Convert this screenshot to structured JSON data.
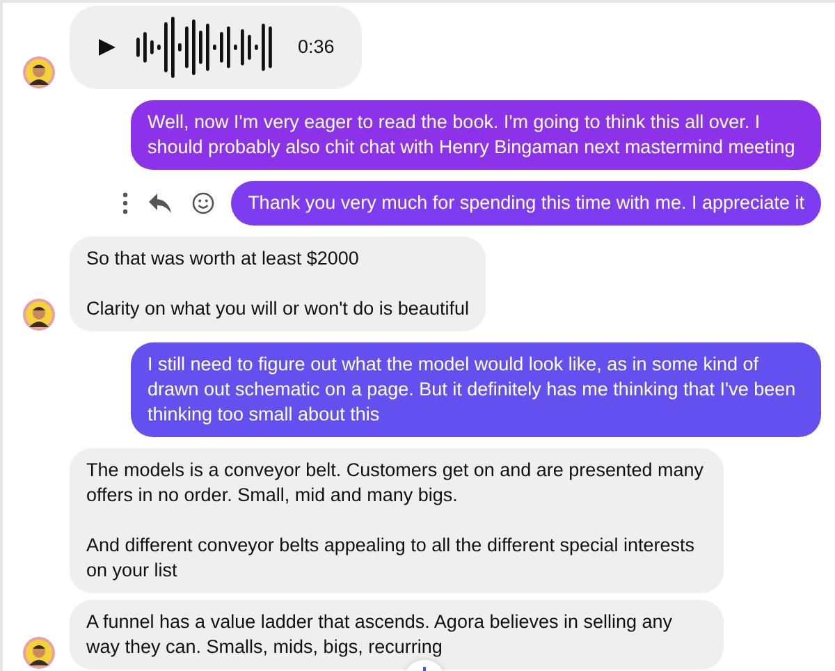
{
  "messages": [
    {
      "kind": "voice",
      "outgoing": false,
      "avatar": true,
      "duration": "0:36"
    },
    {
      "kind": "text",
      "outgoing": true,
      "color": "#8c33ea",
      "text": "Well, now I'm very eager to read the book. I'm going to think this all over. I should probably also chit chat with Henry Bingaman next mastermind meeting",
      "show_actions": false
    },
    {
      "kind": "text",
      "outgoing": true,
      "color": "#7d3cf0",
      "text": "Thank you very much for spending this time with me. I appreciate it",
      "show_actions": true
    },
    {
      "kind": "text",
      "outgoing": false,
      "avatar": true,
      "text": "So that was worth at least $2000\n\nClarity on what you will or won't do is beautiful"
    },
    {
      "kind": "text",
      "outgoing": true,
      "color": "#6450ee",
      "text": "I still need to figure out what the model would look like, as in some kind of drawn out schematic on a page. But it definitely has me thinking that I've been thinking too small about this",
      "show_actions": false
    },
    {
      "kind": "text",
      "outgoing": false,
      "avatar": false,
      "text": "The models is a conveyor belt. Customers get on and are presented many offers in no order. Small, mid and many bigs.\n\nAnd different conveyor belts appealing to all the different special interests on your list"
    },
    {
      "kind": "text",
      "outgoing": false,
      "avatar": true,
      "text": "A funnel has a value ladder that ascends. Agora believes in selling any way they can. Smalls, mids, bigs, recurring"
    }
  ]
}
